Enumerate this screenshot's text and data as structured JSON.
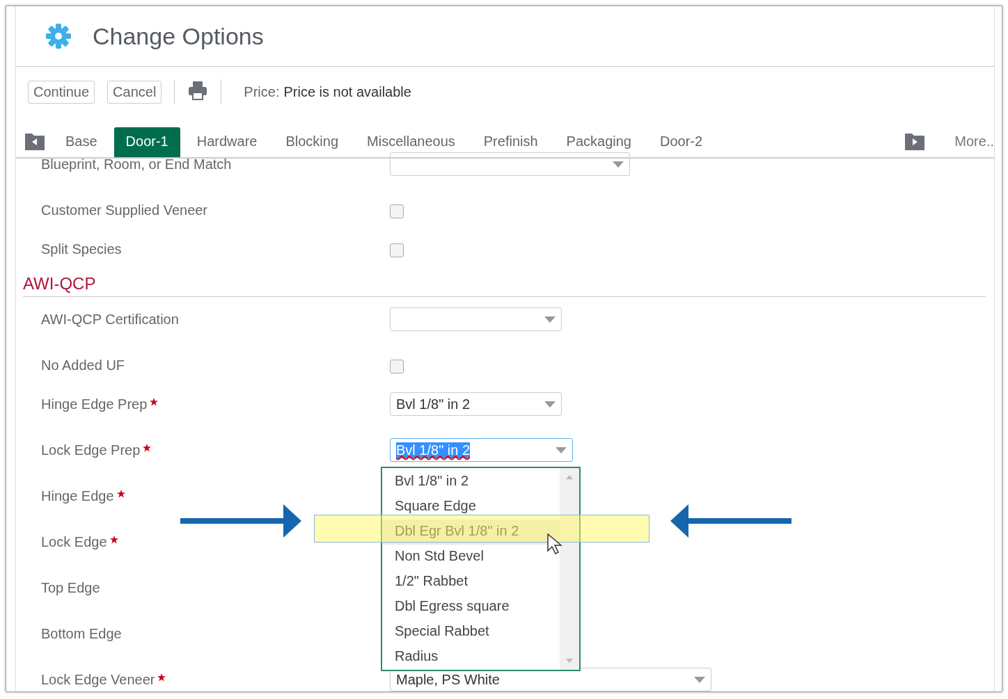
{
  "window": {
    "title": "Change Options"
  },
  "toolbar": {
    "buttons": [
      "Continue",
      "Cancel"
    ],
    "price_label": "Price:",
    "price_value": "Price is not available"
  },
  "tabs": [
    {
      "label": "Base",
      "selected": false
    },
    {
      "label": "Door-1",
      "selected": true
    },
    {
      "label": "Hardware",
      "selected": false
    },
    {
      "label": "Blocking",
      "selected": false
    },
    {
      "label": "Miscellaneous",
      "selected": false
    },
    {
      "label": "Prefinish",
      "selected": false
    },
    {
      "label": "Packaging",
      "selected": false
    },
    {
      "label": "Door-2",
      "selected": false
    }
  ],
  "more_tab": "More..",
  "fields": [
    {
      "kind": "select",
      "label": "Blueprint, Room, or End Match",
      "required": false
    },
    {
      "kind": "checkbox",
      "label": "Customer Supplied Veneer",
      "required": false,
      "checked": false
    },
    {
      "kind": "checkbox",
      "label": "Split Species",
      "required": false,
      "checked": false
    },
    {
      "kind": "section",
      "label": "AWI-QCP"
    },
    {
      "kind": "select",
      "label": "AWI-QCP Certification",
      "required": false
    },
    {
      "kind": "checkbox",
      "label": "No Added UF",
      "required": false,
      "checked": false
    },
    {
      "kind": "select",
      "label": "Hinge Edge Prep",
      "required": true,
      "value": "Bvl 1/8\" in 2"
    },
    {
      "kind": "select",
      "label": "Lock Edge Prep",
      "required": true,
      "value": "Bvl 1/8\" in 2",
      "focused": true
    },
    {
      "kind": "empty",
      "label": "Hinge Edge",
      "required": true
    },
    {
      "kind": "empty",
      "label": "Lock Edge",
      "required": true
    },
    {
      "kind": "empty",
      "label": "Top Edge",
      "required": false
    },
    {
      "kind": "empty",
      "label": "Bottom Edge",
      "required": false
    },
    {
      "kind": "select",
      "label": "Lock Edge Veneer",
      "required": true,
      "value": "Maple, PS White"
    }
  ],
  "dropdown": {
    "options": [
      {
        "label": "Bvl 1/8\" in 2",
        "selected": false
      },
      {
        "label": "Square Edge",
        "selected": false
      },
      {
        "label": "Dbl Egr Bvl 1/8\" in 2",
        "selected": true
      },
      {
        "label": "Non Std Bevel",
        "selected": false
      },
      {
        "label": "1/2\" Rabbet",
        "selected": false
      },
      {
        "label": "Dbl Egress square",
        "selected": false
      },
      {
        "label": "Special Rabbet",
        "selected": false
      },
      {
        "label": "Radius",
        "selected": false
      }
    ]
  }
}
